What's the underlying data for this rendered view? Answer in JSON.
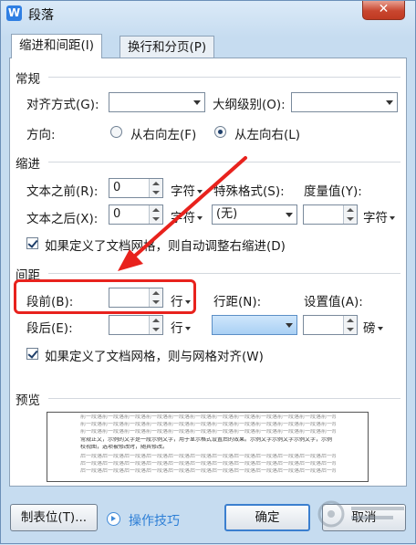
{
  "window": {
    "title": "段落",
    "app_icon_letter": "W",
    "close_symbol": "✕"
  },
  "tabs": [
    {
      "label": "缩进和间距(I)",
      "active": true
    },
    {
      "label": "换行和分页(P)",
      "active": false
    }
  ],
  "general": {
    "title": "常规",
    "alignment_label": "对齐方式(G):",
    "alignment_value": "",
    "outline_label": "大纲级别(O):",
    "outline_value": "",
    "direction_label": "方向:",
    "rtl_label": "从右向左(F)",
    "ltr_label": "从左向右(L)",
    "selected_direction": "ltr"
  },
  "indent": {
    "title": "缩进",
    "before_label": "文本之前(R):",
    "before_value": "0",
    "before_unit": "字符",
    "after_label": "文本之后(X):",
    "after_value": "0",
    "after_unit": "字符",
    "special_label": "特殊格式(S):",
    "special_value": "(无)",
    "measure_label": "度量值(Y):",
    "measure_value": "",
    "measure_unit": "字符",
    "auto_adjust_label": "如果定义了文档网格，则自动调整右缩进(D)",
    "auto_adjust_checked": true
  },
  "spacing": {
    "title": "间距",
    "before_label": "段前(B):",
    "before_value": "",
    "before_unit": "行",
    "after_label": "段后(E):",
    "after_value": "",
    "after_unit": "行",
    "line_label": "行距(N):",
    "line_value": "",
    "setting_label": "设置值(A):",
    "setting_value": "",
    "setting_unit": "磅",
    "snap_grid_label": "如果定义了文档网格，则与网格对齐(W)",
    "snap_grid_checked": true
  },
  "preview": {
    "title": "预览",
    "prev_line": "前一段落前一段落前一段落前一段落前一段落前一段落前一段落前一段落前一段落前一段落前一段落前一段落前一段落",
    "sample_line_1": "常规正文，示例的文字是一段示例文字，用于显示格式设置后的效果。示例文字示例文字示例文字，示例",
    "sample_line_2": "校视图，选项被修改时，随其修改。",
    "next_line": "后一段落后一段落后一段落后一段落后一段落后一段落后一段落后一段落后一段落后一段落后一段落后一段落"
  },
  "footer": {
    "tabs_button": "制表位(T)...",
    "tips_link": "操作技巧",
    "ok_button": "确定",
    "cancel_button": "取消"
  },
  "annotation": {
    "highlight_color": "#e8221d"
  },
  "colors": {
    "accent": "#3b7fcf",
    "link": "#2e7fd6",
    "title_bar": "#c6dcf0"
  }
}
